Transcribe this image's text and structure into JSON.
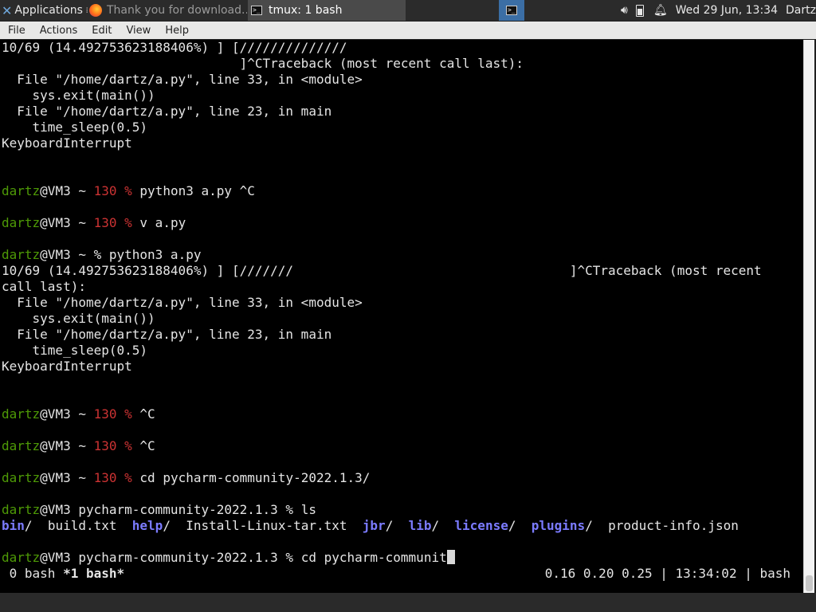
{
  "panel": {
    "apps_label": "Applications",
    "apps_sep": "≡",
    "tasks": [
      {
        "label": "Thank you for download..."
      },
      {
        "label": "tmux: 1 bash"
      }
    ],
    "clock": "Wed 29 Jun, 13:34",
    "user": "Dartz",
    "tray_icons": [
      "volume-icon",
      "battery-icon",
      "notification-bell-icon"
    ]
  },
  "menubar": {
    "items": [
      "File",
      "Actions",
      "Edit",
      "View",
      "Help"
    ]
  },
  "terminal": {
    "prompt_user": "dartz",
    "prompt_host": "@VM3",
    "lines": {
      "l0": "10/69 (14.492753623188406%) ] [//////////////",
      "l1": "                               ]^CTraceback (most recent call last):",
      "l2": "  File \"/home/dartz/a.py\", line 33, in <module>",
      "l3": "    sys.exit(main())",
      "l4": "  File \"/home/dartz/a.py\", line 23, in main",
      "l5": "    time_sleep(0.5)",
      "l6": "KeyboardInterrupt",
      "p1_mid": " ~ ",
      "p1_code": "130 %",
      "p1_cmd": " python3 a.py ^C",
      "p2_mid": " ~ ",
      "p2_code": "130 %",
      "p2_cmd": " v a.py",
      "p3_rest": " ~ % python3 a.py",
      "l16": "10/69 (14.492753623188406%) ] [///////                                    ]^CTraceback (most recent",
      "l17": "call last):",
      "l18": "  File \"/home/dartz/a.py\", line 33, in <module>",
      "l19": "    sys.exit(main())",
      "l20": "  File \"/home/dartz/a.py\", line 23, in main",
      "l21": "    time_sleep(0.5)",
      "l22": "KeyboardInterrupt",
      "p4_mid": " ~ ",
      "p4_code": "130 %",
      "p4_cmd": " ^C",
      "p5_mid": " ~ ",
      "p5_code": "130 %",
      "p5_cmd": " ^C",
      "p6_mid": " ~ ",
      "p6_code": "130 %",
      "p6_cmd": " cd pycharm-community-2022.1.3/",
      "p7_rest": " pycharm-community-2022.1.3 % ls",
      "ls": {
        "bin": "bin",
        "build": "build.txt",
        "help": "help",
        "install": "Install-Linux-tar.txt",
        "jbr": "jbr",
        "lib": "lib",
        "license": "license",
        "plugins": "plugins",
        "product": "product-info.json"
      },
      "p8_rest": " pycharm-community-2022.1.3 % cd pycharm-communit"
    },
    "status": {
      "win0": " 0 bash ",
      "win1": "*1 bash*",
      "right": "0.16 0.20 0.25 | 13:34:02 | bash"
    }
  }
}
